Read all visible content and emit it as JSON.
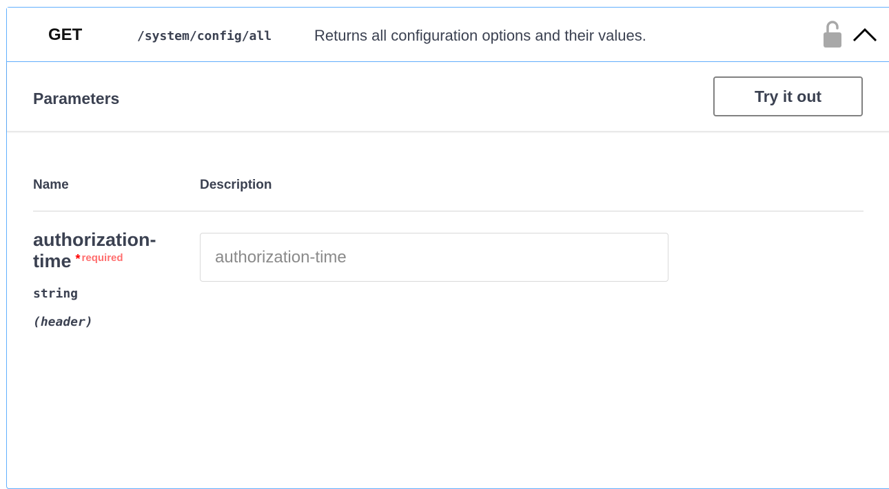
{
  "operation": {
    "method": "GET",
    "path": "/system/config/all",
    "summary": "Returns all configuration options and their values."
  },
  "parameters_section": {
    "title": "Parameters",
    "try_button_label": "Try it out"
  },
  "table": {
    "name_header": "Name",
    "description_header": "Description"
  },
  "parameter": {
    "name_line1": "authorization-",
    "name_line2": "time",
    "required_star": "*",
    "required_label": "required",
    "type": "string",
    "location": "(header)",
    "input_value": "",
    "input_placeholder": "authorization-time"
  },
  "icons": {
    "lock": "unlocked-lock-icon",
    "collapse": "chevron-up-icon"
  },
  "colors": {
    "border_accent": "#61affe",
    "required_red": "#ff0000",
    "required_label": "#ff6f6f",
    "text": "#3b4151"
  }
}
